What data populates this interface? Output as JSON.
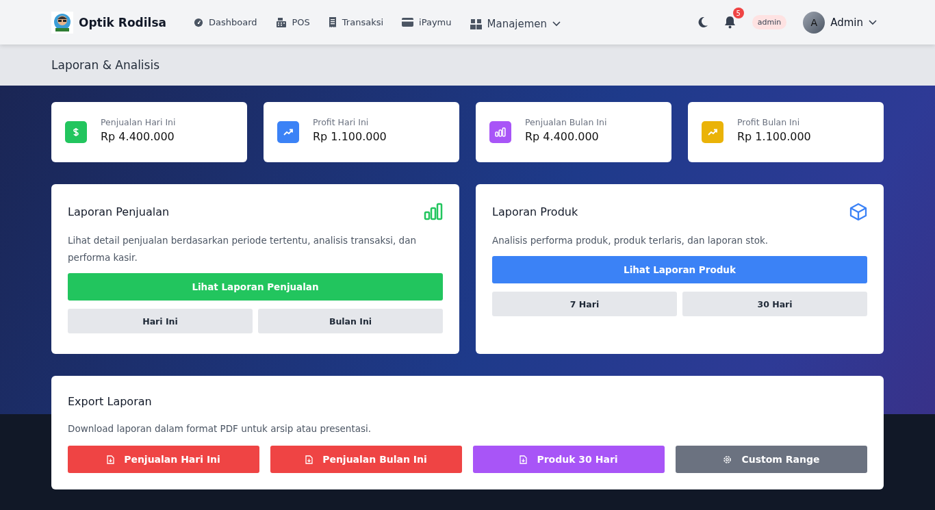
{
  "brand": {
    "name": "Optik Rodilsa"
  },
  "nav": [
    {
      "label": "Dashboard",
      "kind": "gauge",
      "dropdown": false
    },
    {
      "label": "POS",
      "kind": "register",
      "dropdown": false
    },
    {
      "label": "Transaksi",
      "kind": "receipt",
      "dropdown": false
    },
    {
      "label": "iPaymu",
      "kind": "card",
      "dropdown": false
    },
    {
      "label": "Manajemen",
      "kind": "boxes",
      "dropdown": true
    }
  ],
  "notifications": {
    "count": "5"
  },
  "role_badge": "admin",
  "user": {
    "initial": "A",
    "name": "Admin"
  },
  "page_title": "Laporan & Analisis",
  "stats": [
    {
      "label": "Penjualan Hari Ini",
      "value": "Rp 4.400.000",
      "kind": "dollar",
      "color": "#22c55e"
    },
    {
      "label": "Profit Hari Ini",
      "value": "Rp 1.100.000",
      "kind": "trend",
      "color": "#3b82f6"
    },
    {
      "label": "Penjualan Bulan Ini",
      "value": "Rp 4.400.000",
      "kind": "chart",
      "color": "#a855f7"
    },
    {
      "label": "Profit Bulan Ini",
      "value": "Rp 1.100.000",
      "kind": "trend",
      "color": "#eab308"
    }
  ],
  "reports": [
    {
      "title": "Laporan Penjualan",
      "kind": "chart",
      "color": "#22c55e",
      "description": "Lihat detail penjualan berdasarkan periode tertentu, analisis transaksi, dan performa kasir.",
      "primary": "Lihat Laporan Penjualan",
      "options": [
        "Hari Ini",
        "Bulan Ini"
      ]
    },
    {
      "title": "Laporan Produk",
      "kind": "cube",
      "color": "#3b82f6",
      "description": "Analisis performa produk, produk terlaris, dan laporan stok.",
      "primary": "Lihat Laporan Produk",
      "options": [
        "7 Hari",
        "30 Hari"
      ]
    }
  ],
  "export": {
    "title": "Export Laporan",
    "description": "Download laporan dalam format PDF untuk arsip atau presentasi.",
    "buttons": [
      {
        "label": "Penjualan Hari Ini",
        "kind": "file",
        "color": "#ef4444"
      },
      {
        "label": "Penjualan Bulan Ini",
        "kind": "file",
        "color": "#ef4444"
      },
      {
        "label": "Produk 30 Hari",
        "kind": "file",
        "color": "#a855f7"
      },
      {
        "label": "Custom Range",
        "kind": "gear",
        "color": "#6b7280"
      }
    ]
  }
}
